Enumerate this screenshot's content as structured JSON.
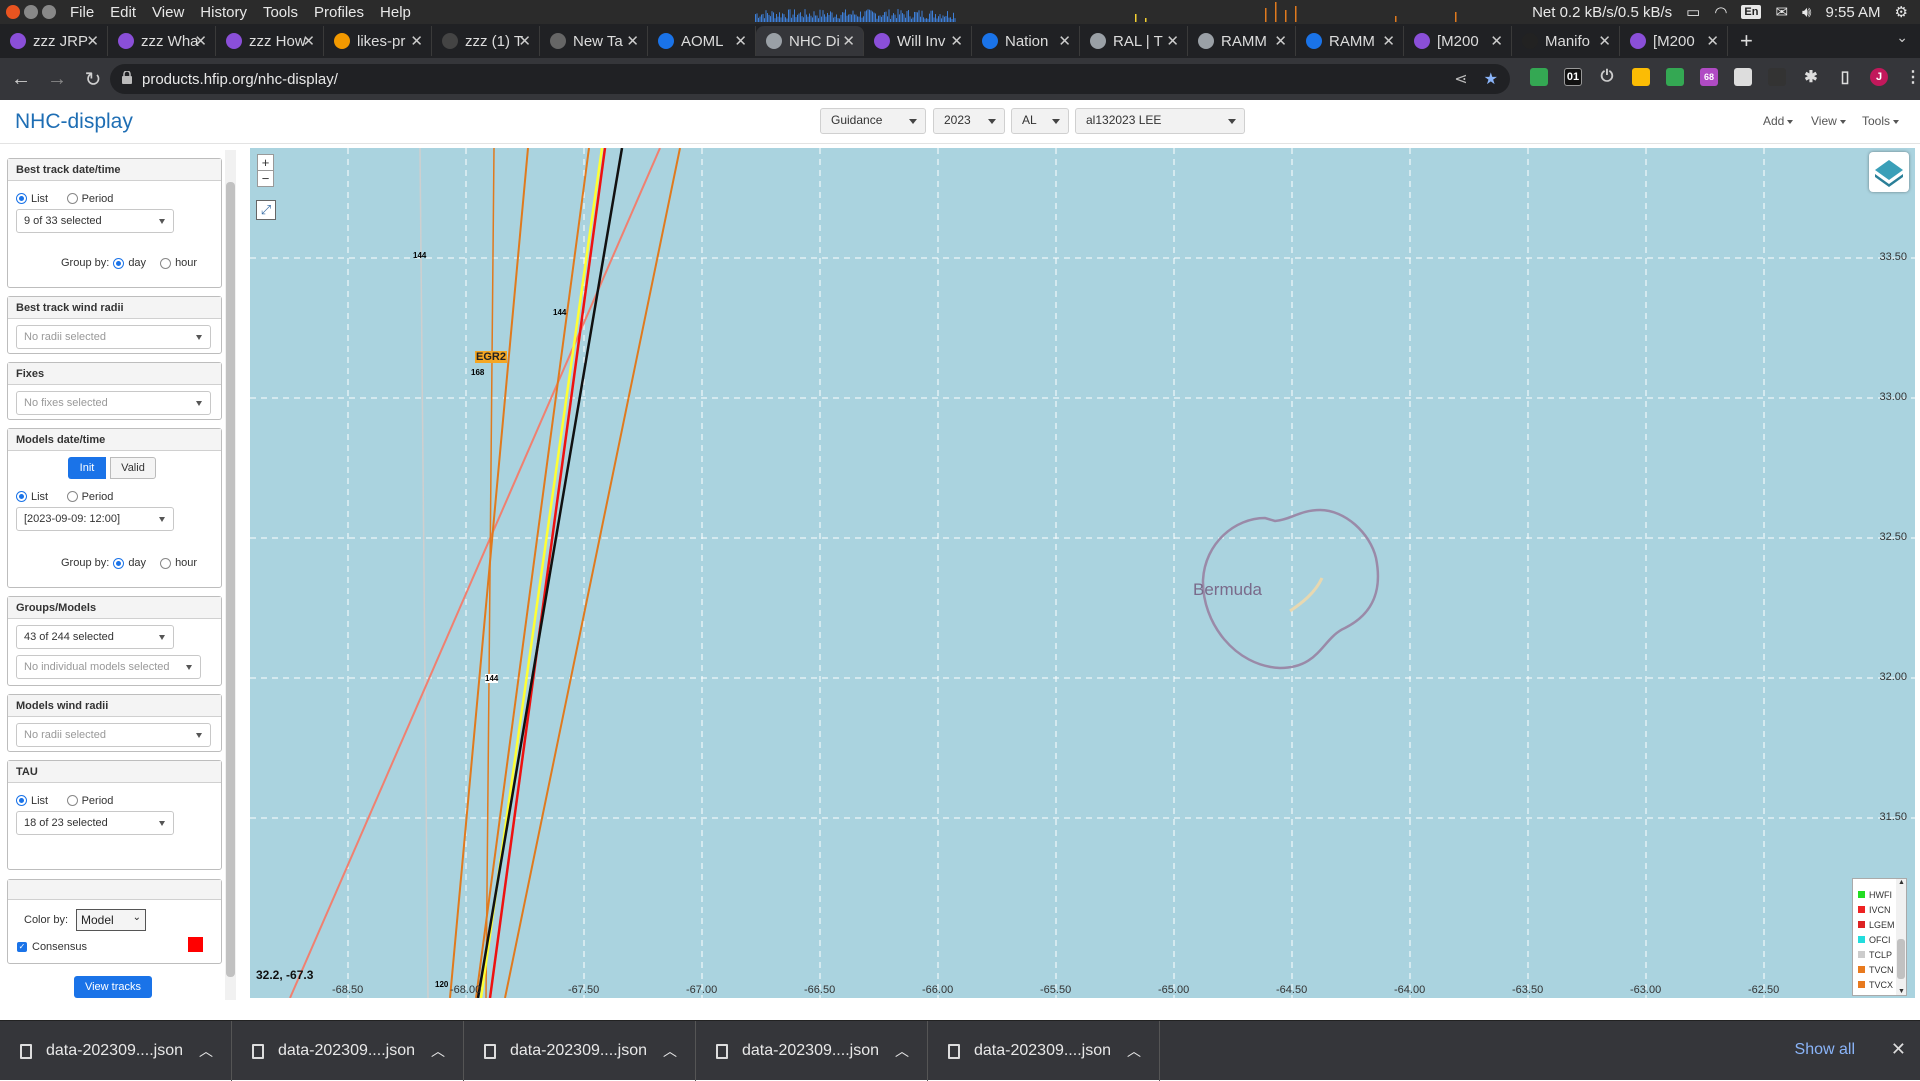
{
  "os": {
    "menu": [
      "File",
      "Edit",
      "View",
      "History",
      "Tools",
      "Profiles",
      "Help"
    ],
    "net": "Net 0.2 kB/s/0.5 kB/s",
    "lang": "En",
    "time": "9:55 AM"
  },
  "tabs": [
    {
      "title": "zzz JRP",
      "icon_color": "#8a4fd8"
    },
    {
      "title": "zzz Wha",
      "icon_color": "#8a4fd8"
    },
    {
      "title": "zzz How",
      "icon_color": "#8a4fd8"
    },
    {
      "title": "likes-pr",
      "icon_color": "#f29900"
    },
    {
      "title": "zzz (1) T",
      "icon_color": "#444444"
    },
    {
      "title": "New Ta",
      "icon_color": "#666666"
    },
    {
      "title": "AOML",
      "icon_color": "#1a73e8"
    },
    {
      "title": "NHC Di",
      "icon_color": "#9aa0a6",
      "active": true
    },
    {
      "title": "Will Inv",
      "icon_color": "#8a4fd8"
    },
    {
      "title": "Nation",
      "icon_color": "#1a73e8"
    },
    {
      "title": "RAL | T",
      "icon_color": "#9aa0a6"
    },
    {
      "title": "RAMM",
      "icon_color": "#9aa0a6"
    },
    {
      "title": "RAMM",
      "icon_color": "#1a73e8"
    },
    {
      "title": "[M200",
      "icon_color": "#8a4fd8"
    },
    {
      "title": "Manifo",
      "icon_color": "#222222"
    },
    {
      "title": "[M200",
      "icon_color": "#8a4fd8"
    }
  ],
  "url": "products.hfip.org/nhc-display/",
  "extensions": {
    "badge1": "01",
    "badge2": "68",
    "avatar": "J"
  },
  "app": {
    "title": "NHC-display",
    "selects": {
      "guidance": "Guidance",
      "year": "2023",
      "basin": "AL",
      "storm": "al132023 LEE"
    },
    "menus": {
      "add": "Add",
      "view": "View",
      "tools": "Tools"
    }
  },
  "sidebar": {
    "best_track": {
      "title": "Best track date/time",
      "list": "List",
      "period": "Period",
      "selected": "9 of 33 selected",
      "group_by": "Group by:",
      "day": "day",
      "hour": "hour"
    },
    "best_track_wind": {
      "title": "Best track wind radii",
      "placeholder": "No radii selected"
    },
    "fixes": {
      "title": "Fixes",
      "placeholder": "No fixes selected"
    },
    "models_dt": {
      "title": "Models date/time",
      "init": "Init",
      "valid": "Valid",
      "list": "List",
      "period": "Period",
      "selected": "[2023-09-09: 12:00]",
      "group_by": "Group by:",
      "day": "day",
      "hour": "hour"
    },
    "groups": {
      "title": "Groups/Models",
      "selected": "43 of 244 selected",
      "individual": "No individual models selected"
    },
    "models_wind": {
      "title": "Models wind radii",
      "placeholder": "No radii selected"
    },
    "tau": {
      "title": "TAU",
      "list": "List",
      "period": "Period",
      "selected": "18 of 23 selected"
    },
    "color": {
      "label": "Color by:",
      "value": "Model",
      "consensus": "Consensus",
      "consensus_color": "#ff0000"
    },
    "view_tracks": "View tracks"
  },
  "map": {
    "coords": "32.2, -67.3",
    "island": "Bermuda",
    "lat_labels": [
      "33.50",
      "33.00",
      "32.50",
      "32.00",
      "31.50"
    ],
    "lon_labels": [
      "-68.50",
      "-68.00",
      "-67.50",
      "-67.00",
      "-66.50",
      "-66.00",
      "-65.50",
      "-65.00",
      "-64.50",
      "-64.00",
      "-63.50",
      "-63.00",
      "-62.50"
    ],
    "tau_labels": [
      "144",
      "144",
      "168",
      "144",
      "120"
    ],
    "track_label": "EGR2",
    "legend": [
      {
        "name": "HWFI",
        "color": "#22dd22"
      },
      {
        "name": "IVCN",
        "color": "#ee2222"
      },
      {
        "name": "LGEM",
        "color": "#dd2222"
      },
      {
        "name": "OFCI",
        "color": "#22dddd"
      },
      {
        "name": "TCLP",
        "color": "#cccccc"
      },
      {
        "name": "TVCN",
        "color": "#e87a1e"
      },
      {
        "name": "TVCX",
        "color": "#e87a1e"
      }
    ]
  },
  "downloads": {
    "items": [
      "data-202309....json",
      "data-202309....json",
      "data-202309....json",
      "data-202309....json",
      "data-202309....json"
    ],
    "show_all": "Show all"
  }
}
